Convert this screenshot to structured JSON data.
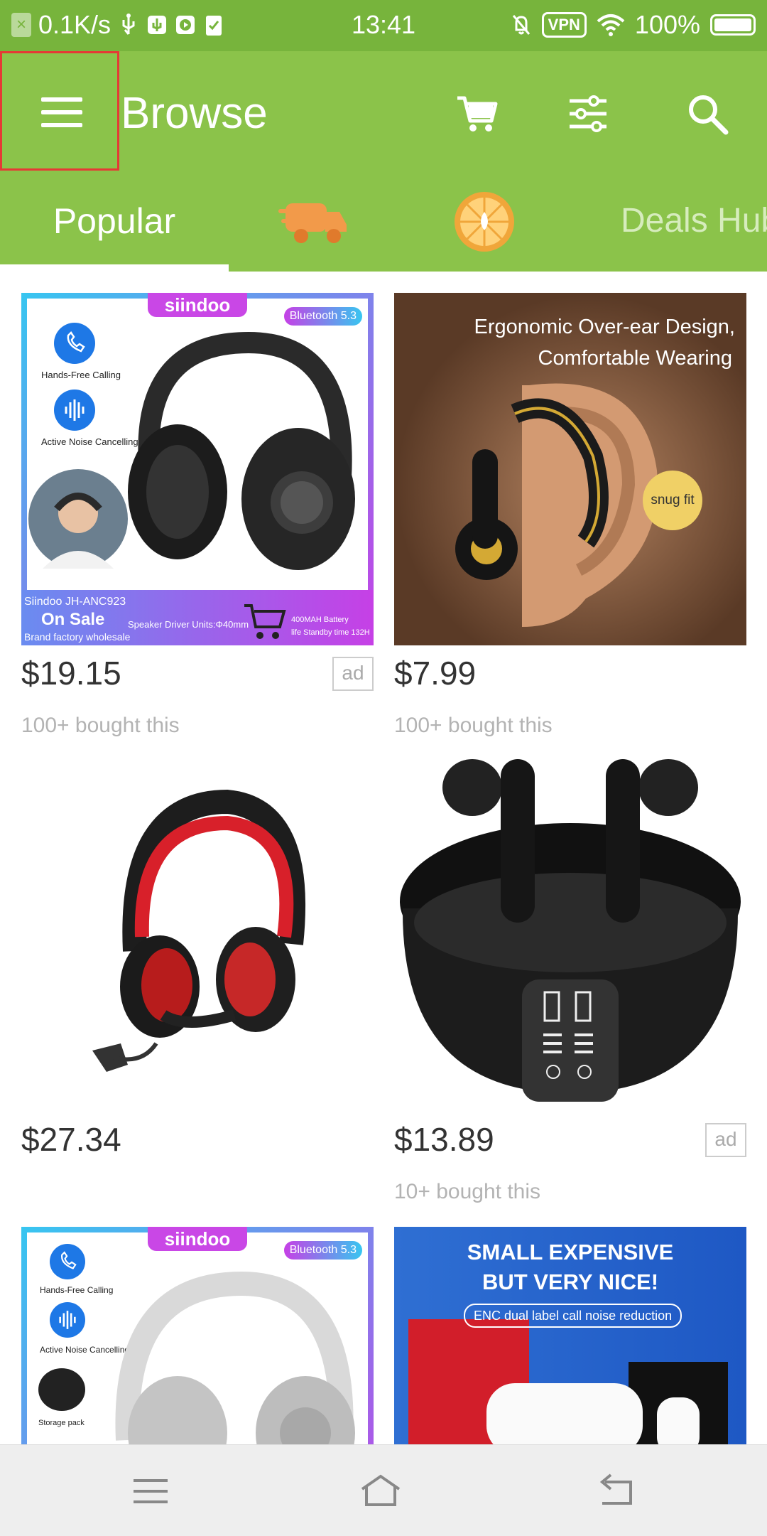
{
  "status_bar": {
    "speed": "0.1K/s",
    "time": "13:41",
    "vpn": "VPN",
    "battery": "100%"
  },
  "app_bar": {
    "title": "Browse",
    "icons": [
      "menu-icon",
      "cart-icon",
      "filter-icon",
      "search-icon"
    ],
    "color": "#8bc34a"
  },
  "tabs": {
    "active": "Popular",
    "deals": "Deals Hub",
    "icons": [
      "shipping-truck-icon",
      "coin-icon"
    ]
  },
  "products": [
    {
      "price": "$19.15",
      "ad": "ad",
      "bought": "100+ bought this",
      "image": {
        "brand": "siindoo",
        "bluetooth": "Bluetooth 5.3",
        "feature1": "Hands-Free Calling",
        "feature2": "Active Noise Cancelling",
        "model": "Siindoo JH-ANC923",
        "sale": "On Sale",
        "wholesale": "Brand factory wholesale",
        "driver": "Speaker Driver Units:Φ40mm",
        "battery": "400MAH Battery",
        "standby": "life Standby time 132H"
      }
    },
    {
      "price": "$7.99",
      "bought": "100+ bought this",
      "image": {
        "headline1": "Ergonomic Over-ear Design,",
        "headline2": "Comfortable Wearing",
        "badge": "snug fit"
      }
    },
    {
      "price": "$27.34"
    },
    {
      "price": "$13.89",
      "ad": "ad",
      "bought": "10+ bought this"
    },
    {
      "image": {
        "brand": "siindoo",
        "bluetooth": "Bluetooth 5.3",
        "feature1": "Hands-Free Calling",
        "feature2": "Active Noise Cancelling",
        "storage": "Storage pack"
      }
    },
    {
      "image": {
        "line1": "SMALL EXPENSIVE",
        "line2": "BUT VERY NICE!",
        "pill": "ENC dual label call noise reduction"
      }
    }
  ]
}
